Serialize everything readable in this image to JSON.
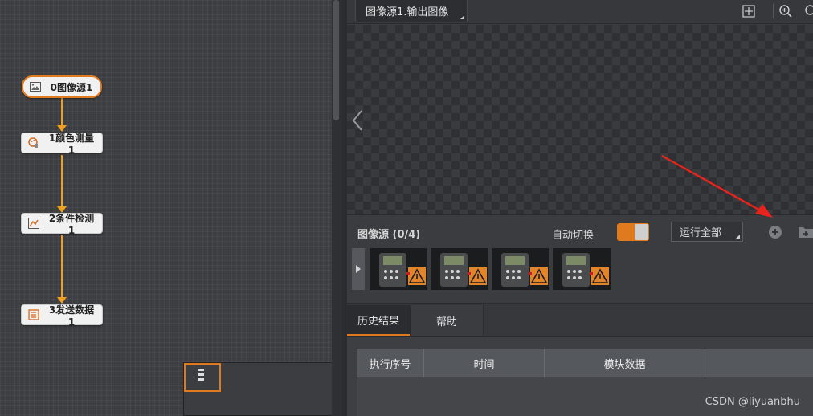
{
  "flow": {
    "nodes": [
      {
        "id": "0",
        "label": "0图像源1",
        "icon": "image-icon",
        "selected": true
      },
      {
        "id": "1",
        "label": "1颜色测量1",
        "icon": "color-measure-icon",
        "selected": false
      },
      {
        "id": "2",
        "label": "2条件检测1",
        "icon": "condition-detect-icon",
        "selected": false
      },
      {
        "id": "3",
        "label": "3发送数据1",
        "icon": "send-data-icon",
        "selected": false
      }
    ]
  },
  "image_panel": {
    "tab_label": "图像源1.输出图像",
    "toolbar_icons": [
      "fit-window-icon",
      "zoom-in-icon"
    ]
  },
  "source_bar": {
    "title": "图像源 (0/4)",
    "auto_switch_label": "自动切换",
    "auto_switch_on": true,
    "run_all_label": "运行全部"
  },
  "thumbnails": [
    {
      "name": "thumbnail-1"
    },
    {
      "name": "thumbnail-2"
    },
    {
      "name": "thumbnail-3"
    },
    {
      "name": "thumbnail-4"
    }
  ],
  "bottom_tabs": [
    {
      "label": "历史结果",
      "active": true
    },
    {
      "label": "帮助",
      "active": false
    }
  ],
  "history_table": {
    "columns": [
      "执行序号",
      "时间",
      "模块数据",
      ""
    ]
  },
  "colors": {
    "accent": "#e07a1f",
    "flow_line": "#f0a020",
    "annotation_arrow": "#e8231c"
  },
  "watermark": "CSDN @liyuanbhu"
}
